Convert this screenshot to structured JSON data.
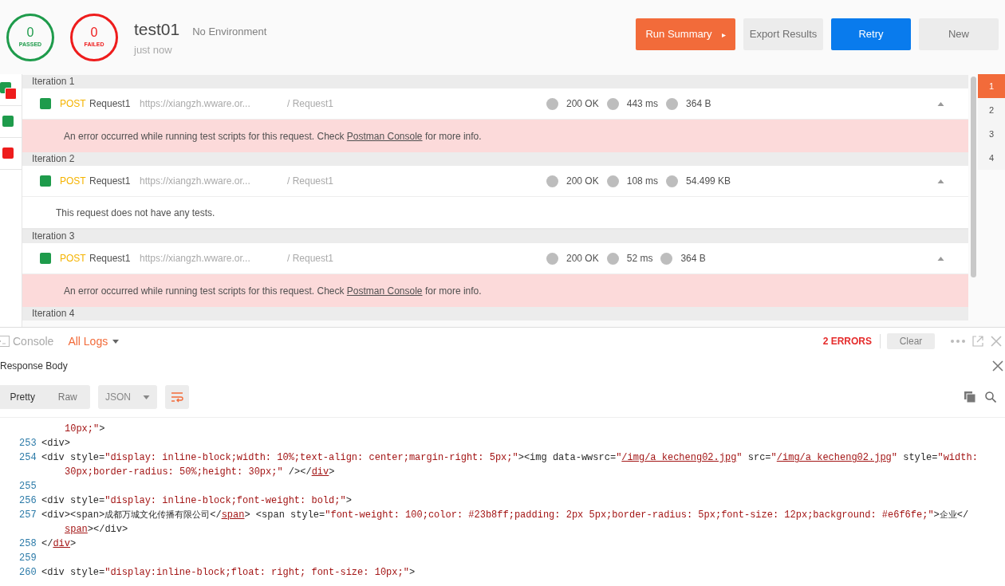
{
  "summary": {
    "passed": {
      "count": "0",
      "label": "PASSED"
    },
    "failed": {
      "count": "0",
      "label": "FAILED"
    },
    "title": "test01",
    "environment": "No Environment",
    "time": "just now"
  },
  "actions": [
    {
      "label": "Run Summary",
      "kind": "primary",
      "caret": "▸"
    },
    {
      "label": "Export Results",
      "kind": "plain"
    },
    {
      "label": "Retry",
      "kind": "blue"
    },
    {
      "label": "New",
      "kind": "plain"
    }
  ],
  "markers": [
    {
      "kind": "mixed"
    },
    {
      "kind": "pass"
    },
    {
      "kind": "fail"
    }
  ],
  "iterations": [
    {
      "label": "Iteration 1",
      "request": {
        "color": "#1e9b4b",
        "method": "POST",
        "name": "Request1",
        "url": "https://xiangzh.wware.or...",
        "path": "/ Request1",
        "status": "200 OK",
        "time": "443 ms",
        "size": "364 B",
        "expanded": true
      },
      "result": {
        "kind": "error",
        "before": "An error occurred while running test scripts for this request. Check ",
        "link": "Postman Console",
        "after": " for more info."
      }
    },
    {
      "label": "Iteration 2",
      "request": {
        "color": "#1e9b4b",
        "method": "POST",
        "name": "Request1",
        "url": "https://xiangzh.wware.or...",
        "path": "/ Request1",
        "status": "200 OK",
        "time": "108 ms",
        "size": "54.499 KB",
        "expanded": true
      },
      "result": {
        "kind": "none",
        "before": "This request does not have any tests."
      }
    },
    {
      "label": "Iteration 3",
      "request": {
        "color": "#1e9b4b",
        "method": "POST",
        "name": "Request1",
        "url": "https://xiangzh.wware.or...",
        "path": "/ Request1",
        "status": "200 OK",
        "time": "52 ms",
        "size": "364 B",
        "expanded": true
      },
      "result": {
        "kind": "error",
        "before": "An error occurred while running test scripts for this request. Check ",
        "link": "Postman Console",
        "after": " for more info."
      }
    },
    {
      "label": "Iteration 4"
    }
  ],
  "pages": [
    {
      "label": "1",
      "selected": true
    },
    {
      "label": "2",
      "selected": false
    },
    {
      "label": "3",
      "selected": false
    },
    {
      "label": "4",
      "selected": false
    }
  ],
  "console": {
    "title": "Console",
    "filter": "All Logs",
    "errors": "2 ERRORS",
    "clear": "Clear"
  },
  "response": {
    "title": "Response Body",
    "views": [
      {
        "label": "Pretty",
        "selected": true
      },
      {
        "label": "Raw",
        "selected": false
      }
    ],
    "format": "JSON"
  },
  "code": [
    {
      "tokens": [
        {
          "kind": "value",
          "text": "10px;\""
        },
        {
          "kind": "tag",
          "text": ">"
        }
      ]
    },
    {
      "number": "253",
      "tokens": [
        {
          "kind": "tag",
          "text": "<div>"
        }
      ]
    },
    {
      "number": "254",
      "tokens": [
        {
          "kind": "tag",
          "text": "<div style="
        },
        {
          "kind": "value",
          "text": "\"display: inline-block;width: 10%;text-align: center;margin-right: 5px;\""
        },
        {
          "kind": "tag",
          "text": "><img data-wwsrc="
        },
        {
          "kind": "value",
          "text": "\""
        },
        {
          "kind": "link",
          "text": "/img/a_kecheng02.jpg"
        },
        {
          "kind": "value",
          "text": "\""
        },
        {
          "kind": "tag",
          "text": " src="
        },
        {
          "kind": "value",
          "text": "\""
        },
        {
          "kind": "link",
          "text": "/img/a_kecheng02.jpg"
        },
        {
          "kind": "value",
          "text": "\""
        },
        {
          "kind": "tag",
          "text": " style="
        },
        {
          "kind": "value",
          "text": "\"width:"
        }
      ]
    },
    {
      "tokens": [
        {
          "kind": "value",
          "text": "30px;border-radius: 50%;height: 30px;\""
        },
        {
          "kind": "tag",
          "text": " /></"
        },
        {
          "kind": "link",
          "text": "div"
        },
        {
          "kind": "tag",
          "text": ">"
        }
      ]
    },
    {
      "number": "255"
    },
    {
      "number": "256",
      "tokens": [
        {
          "kind": "tag",
          "text": "<div style="
        },
        {
          "kind": "value",
          "text": "\"display: inline-block;font-weight: bold;\""
        },
        {
          "kind": "tag",
          "text": ">"
        }
      ]
    },
    {
      "number": "257",
      "tokens": [
        {
          "kind": "tag",
          "text": "<div><span>"
        },
        {
          "kind": "text",
          "text": "成都万城文化传播有限公司"
        },
        {
          "kind": "tag",
          "text": "</"
        },
        {
          "kind": "link",
          "text": "span"
        },
        {
          "kind": "tag",
          "text": "> <span style="
        },
        {
          "kind": "value",
          "text": "\"font-weight: 100;color: #23b8ff;padding: 2px 5px;border-radius: 5px;font-size: 12px;background: #e6f6fe;\""
        },
        {
          "kind": "tag",
          "text": ">"
        },
        {
          "kind": "text",
          "text": "企业"
        },
        {
          "kind": "tag",
          "text": "</"
        }
      ]
    },
    {
      "tokens": [
        {
          "kind": "link",
          "text": "span"
        },
        {
          "kind": "tag",
          "text": "></div>"
        }
      ]
    },
    {
      "number": "258",
      "tokens": [
        {
          "kind": "tag",
          "text": "</"
        },
        {
          "kind": "link",
          "text": "div"
        },
        {
          "kind": "tag",
          "text": ">"
        }
      ]
    },
    {
      "number": "259"
    },
    {
      "number": "260",
      "tokens": [
        {
          "kind": "tag",
          "text": "<div style="
        },
        {
          "kind": "value",
          "text": "\"display:inline-block;float: right; font-size: 10px;\""
        },
        {
          "kind": "tag",
          "text": ">"
        }
      ]
    }
  ]
}
